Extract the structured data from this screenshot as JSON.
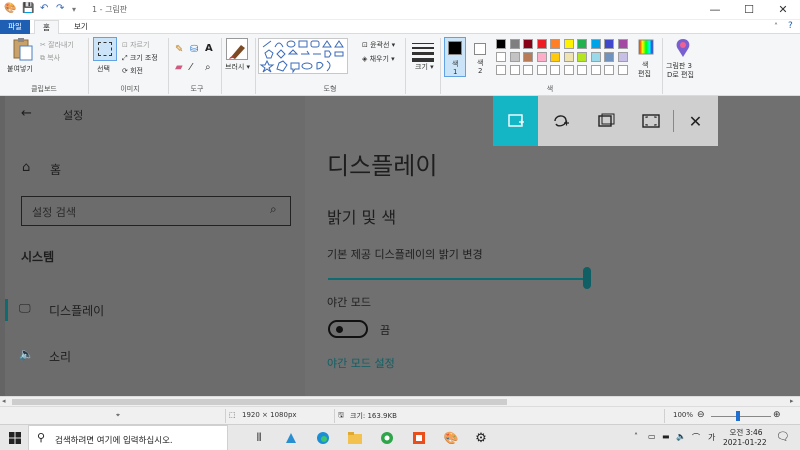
{
  "window": {
    "title": "1 - 그림판",
    "minimize": "—",
    "maximize": "☐",
    "close": "✕"
  },
  "tabs": {
    "file": "파일",
    "home": "홈",
    "view": "보기"
  },
  "ribbon": {
    "clipboard": {
      "paste": "붙여넣기",
      "cut": "잘라내기",
      "copy": "복사",
      "label": "클립보드"
    },
    "image": {
      "select": "선택",
      "crop": "자르기",
      "resize": "크기 조정",
      "rotate": "회전",
      "label": "이미지"
    },
    "tools": {
      "label": "도구"
    },
    "brushes": {
      "label": "브러시"
    },
    "shapes": {
      "outline": "윤곽선",
      "fill": "채우기",
      "label": "도형"
    },
    "size": {
      "label": "크기"
    },
    "colors": {
      "color1": "색\n1",
      "color1_a": "색",
      "color1_b": "1",
      "color2_a": "색",
      "color2_b": "2",
      "edit_a": "색",
      "edit_b": "편집",
      "label": "색",
      "palette_row1": [
        "#000000",
        "#7f7f7f",
        "#880015",
        "#ed1c24",
        "#ff7f27",
        "#fff200",
        "#22b14c",
        "#00a2e8",
        "#3f48cc",
        "#a349a4"
      ],
      "palette_row2": [
        "#ffffff",
        "#c3c3c3",
        "#b97a57",
        "#ffaec9",
        "#ffc90e",
        "#efe4b0",
        "#b5e61d",
        "#99d9ea",
        "#7092be",
        "#c8bfe7"
      ]
    },
    "paint3d": {
      "line1": "그림판 3",
      "line2": "D로 편집"
    }
  },
  "settings": {
    "title": "설정",
    "home": "홈",
    "search_placeholder": "설정 검색",
    "section": "시스템",
    "nav_display": "디스플레이",
    "nav_sound": "소리",
    "page_title": "디스플레이",
    "brightness_heading": "밝기 및 색",
    "brightness_label": "기본 제공 디스플레이의 밝기 변경",
    "brightness_level": 100,
    "night_mode": "야간 모드",
    "night_state": "끔",
    "night_settings": "야간 모드 설정",
    "accent": "#0f6b70"
  },
  "status": {
    "dimensions": "1920 × 1080px",
    "filesize": "크기: 163.9KB",
    "zoom": "100%"
  },
  "taskbar": {
    "search_placeholder": "검색하려면 여기에 입력하십시오.",
    "ime": "가",
    "time": "오전 3:46",
    "date": "2021-01-22"
  }
}
